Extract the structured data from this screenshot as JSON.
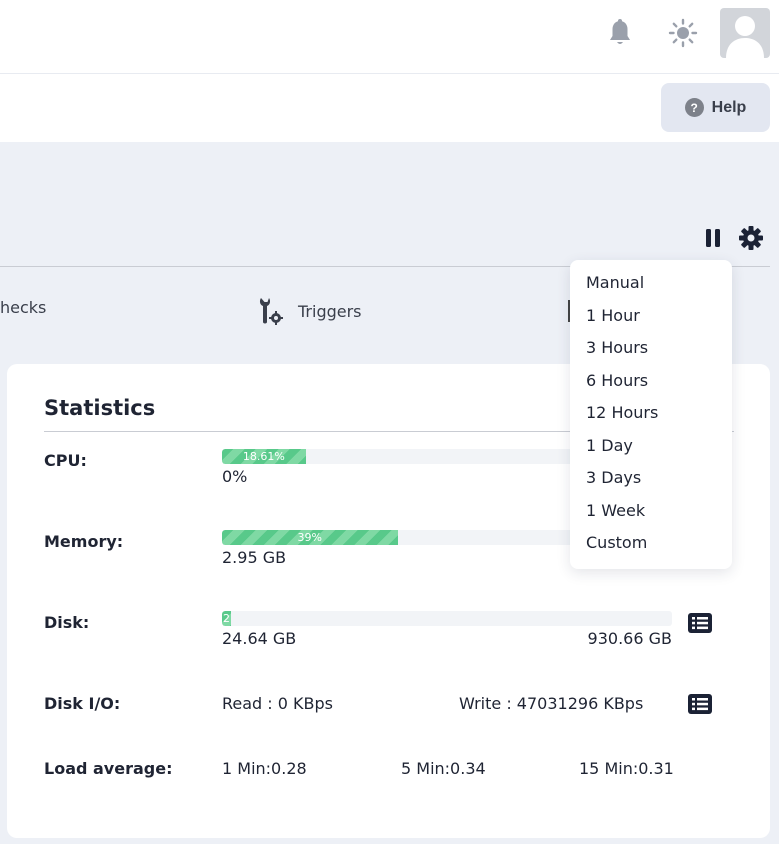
{
  "header": {
    "icons": {
      "notifications": "bell-icon",
      "theme": "sun-icon",
      "profile": "user-avatar-icon"
    }
  },
  "help": {
    "label": "Help",
    "icon_glyph": "?"
  },
  "toolbar": {
    "pause": "pause-icon",
    "settings": "gear-icon"
  },
  "tabs": {
    "checks_label": "hecks",
    "triggers_label": "Triggers"
  },
  "refresh_menu": {
    "options": [
      "Manual",
      "1 Hour",
      "3 Hours",
      "6 Hours",
      "12 Hours",
      "1 Day",
      "3 Days",
      "1 Week",
      "Custom"
    ]
  },
  "statistics": {
    "title": "Statistics",
    "cpu": {
      "label": "CPU:",
      "percent_text": "18.61%",
      "percent": 18.61,
      "value": "0%"
    },
    "memory": {
      "label": "Memory:",
      "percent_text": "39%",
      "percent": 39,
      "value": "2.95 GB"
    },
    "disk": {
      "label": "Disk:",
      "percent_text": "2",
      "percent": 2,
      "used": "24.64 GB",
      "total": "930.66 GB"
    },
    "disk_io": {
      "label": "Disk I/O:",
      "read": "Read : 0 KBps",
      "write": "Write : 47031296 KBps"
    },
    "load": {
      "label": "Load average:",
      "one": "1 Min:0.28",
      "five": "5 Min:0.34",
      "fifteen": "15 Min:0.31"
    }
  },
  "colors": {
    "bar_fill": "#58c98a",
    "bar_track": "#f2f4f7",
    "page_bg": "#edf0f6",
    "accent_dark": "#1b2235"
  }
}
